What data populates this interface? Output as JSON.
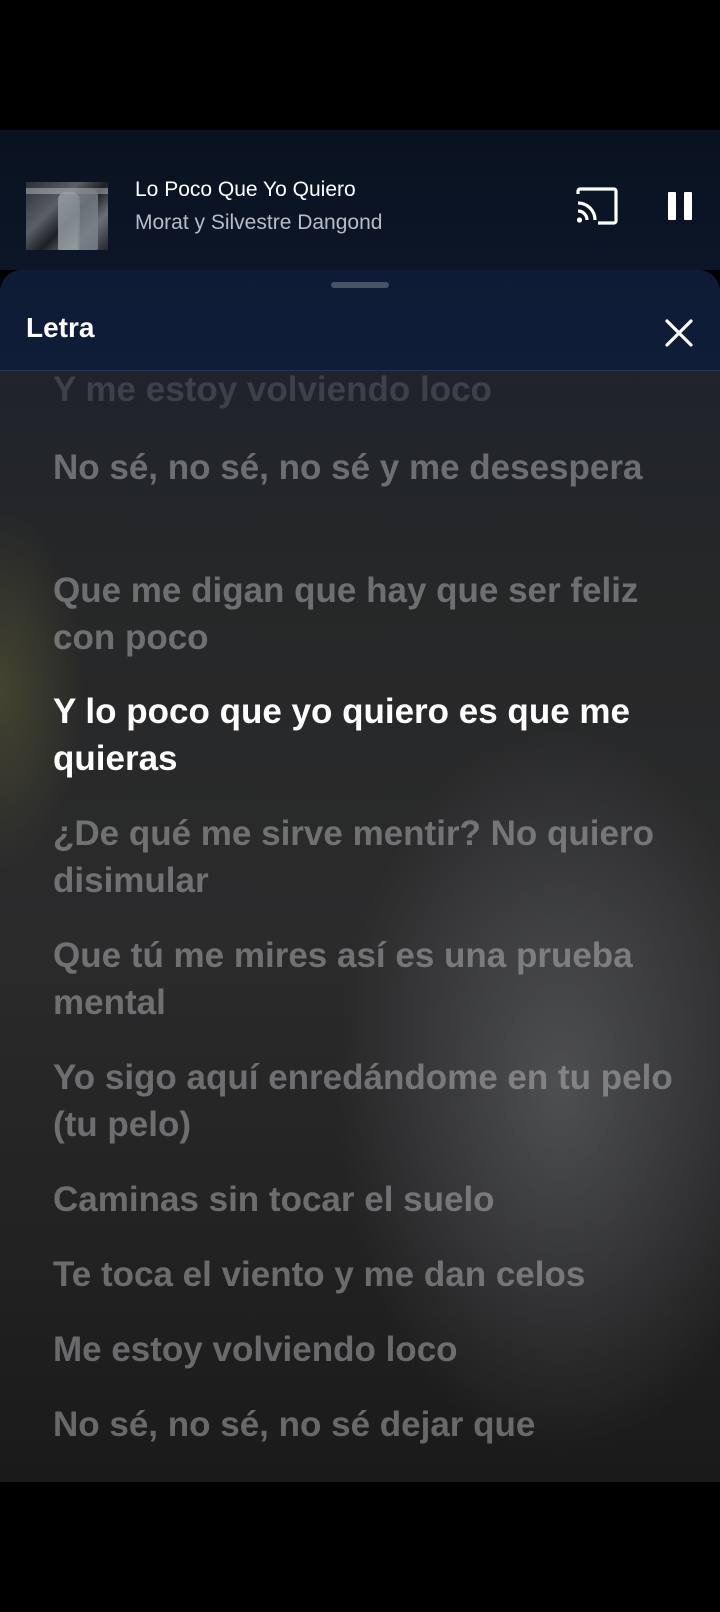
{
  "now_playing": {
    "title": "Lo Poco Que Yo Quiero",
    "artist": "Morat y Silvestre Dangond",
    "cast_icon": "cast-icon",
    "pause_icon": "pause-icon"
  },
  "lyrics_panel": {
    "title": "Letra",
    "close_icon": "close-icon",
    "lines": [
      "Y me estoy volviendo loco",
      "No sé, no sé, no sé y me desespera",
      "Que me digan que hay que ser feliz con poco",
      "Y lo poco que yo quiero es que me quieras",
      "¿De qué me sirve mentir? No quiero disimular",
      "Que tú me mires así es una prueba mental",
      "Yo sigo aquí enredándome en tu pelo (tu pelo)",
      "Caminas sin tocar el suelo",
      "Te toca el viento y me dan celos",
      "Me estoy volviendo loco",
      "No sé, no sé, no sé dejar que"
    ],
    "active_line": 3
  },
  "colors": {
    "header_bg": "#0f1d38",
    "active_lyric": "#ffffff",
    "inactive_lyric": "#c8c8cc"
  }
}
